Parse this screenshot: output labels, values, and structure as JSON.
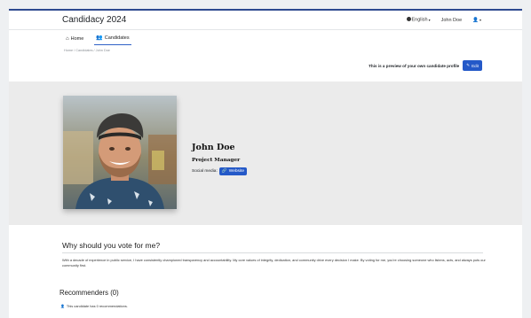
{
  "app": {
    "title": "Candidacy 2024"
  },
  "navbar": {
    "language": "English",
    "user": "John Doe"
  },
  "tabs": [
    {
      "label": "Home"
    },
    {
      "label": "Candidates"
    }
  ],
  "breadcrumb": "Home / Candidates / John Doe",
  "preview": {
    "text": "This is a preview of your own candidate profile",
    "edit_label": "Edit"
  },
  "profile": {
    "name": "John Doe",
    "role": "Project Manager",
    "social_label": "Social media:",
    "website_label": "Website"
  },
  "why": {
    "title": "Why should you vote for me?",
    "text": "With a decade of experience in public service, I have consistently championed transparency and accountability. My core values of integrity, dedication, and community drive every decision I make. By voting for me, you're choosing someone who listens, acts, and always puts our community first."
  },
  "recommenders": {
    "title": "Recommenders (0)",
    "text": "This candidate has 0 recommendations."
  },
  "colors": {
    "accent": "#2459c8",
    "hero_bg": "#ebebeb",
    "top_border": "#2e4a8f"
  }
}
